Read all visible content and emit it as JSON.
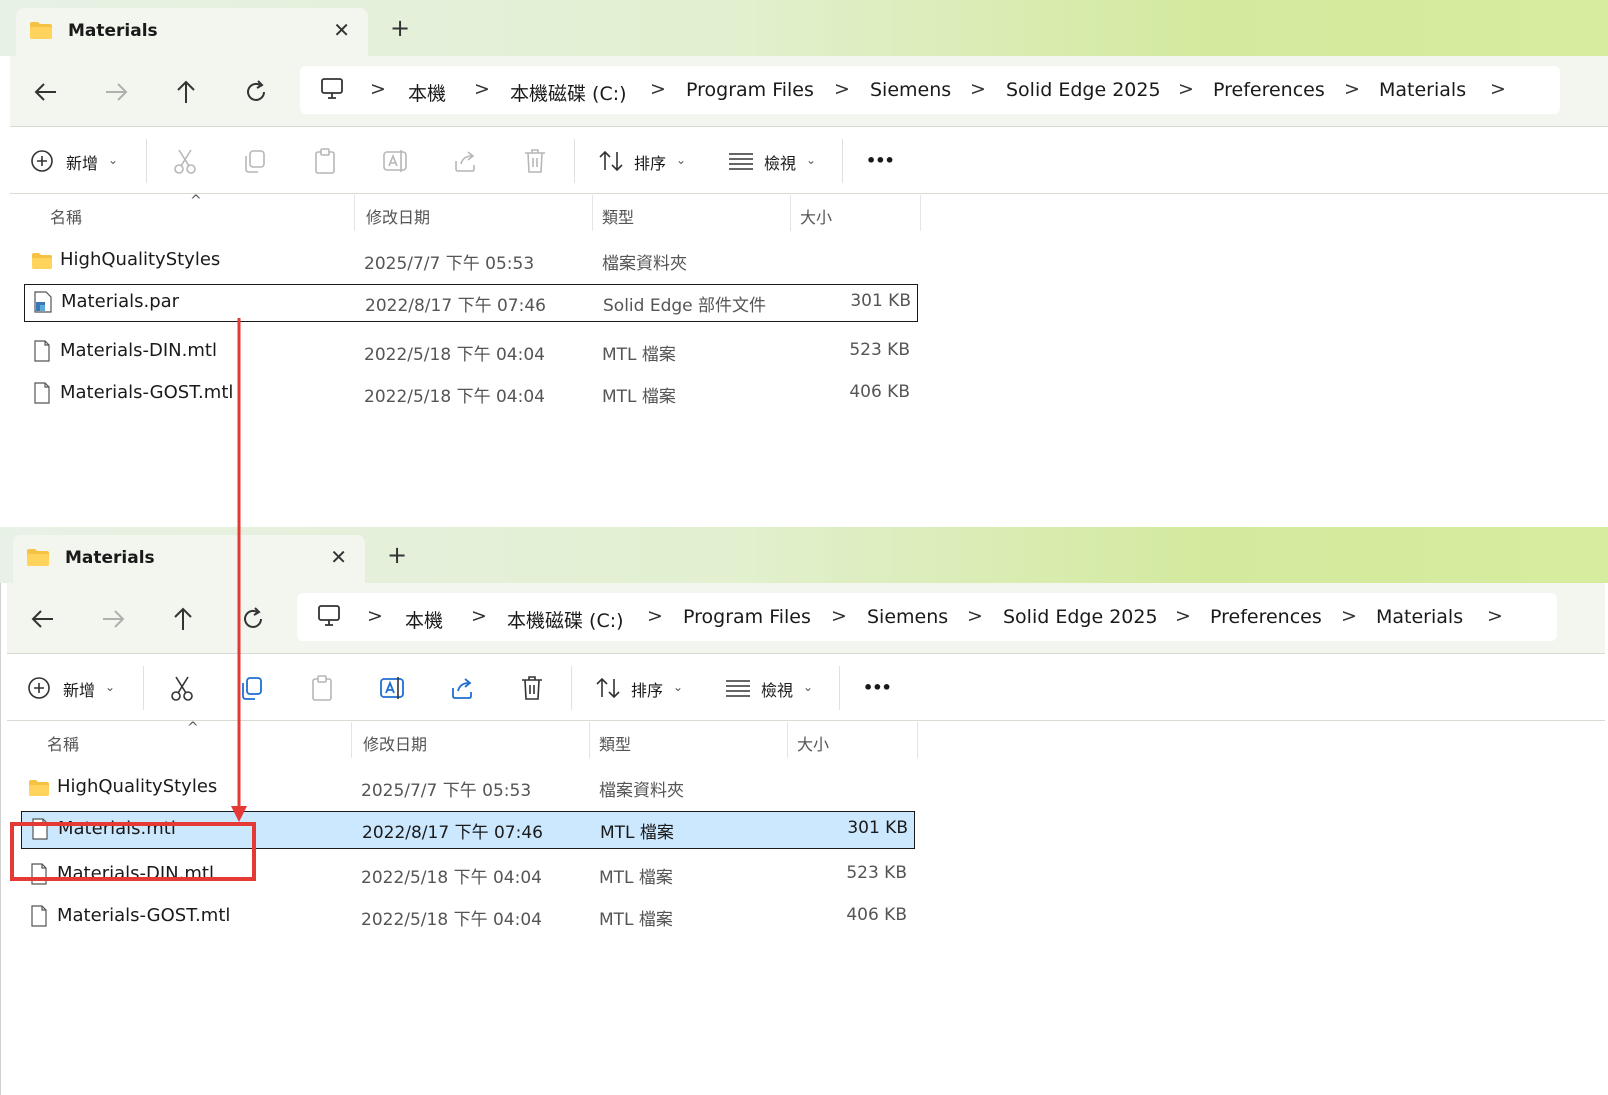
{
  "tab": {
    "title": "Materials",
    "close": "✕",
    "new_tab": "+"
  },
  "breadcrumbs": [
    "本機",
    "本機磁碟 (C:)",
    "Program Files",
    "Siemens",
    "Solid Edge 2025",
    "Preferences",
    "Materials"
  ],
  "toolbar": {
    "new_label": "新增",
    "sort_label": "排序",
    "view_label": "檢視",
    "more_label": "•••"
  },
  "columns": {
    "name": "名稱",
    "date": "修改日期",
    "type": "類型",
    "size": "大小"
  },
  "top_window": {
    "files": [
      {
        "name": "HighQualityStyles",
        "date": "2025/7/7 下午 05:53",
        "type": "檔案資料夾",
        "size": "",
        "icon": "folder-icon"
      },
      {
        "name": "Materials.par",
        "date": "2022/8/17 下午 07:46",
        "type": "Solid Edge 部件文件",
        "size": "301 KB",
        "icon": "part-file-icon"
      },
      {
        "name": "Materials-DIN.mtl",
        "date": "2022/5/18 下午 04:04",
        "type": "MTL 檔案",
        "size": "523 KB",
        "icon": "file-icon"
      },
      {
        "name": "Materials-GOST.mtl",
        "date": "2022/5/18 下午 04:04",
        "type": "MTL 檔案",
        "size": "406 KB",
        "icon": "file-icon"
      }
    ]
  },
  "bottom_window": {
    "files": [
      {
        "name": "HighQualityStyles",
        "date": "2025/7/7 下午 05:53",
        "type": "檔案資料夾",
        "size": "",
        "icon": "folder-icon"
      },
      {
        "name": "Materials.mtl",
        "date": "2022/8/17 下午 07:46",
        "type": "MTL 檔案",
        "size": "301 KB",
        "icon": "file-icon"
      },
      {
        "name": "Materials-DIN.mtl",
        "date": "2022/5/18 下午 04:04",
        "type": "MTL 檔案",
        "size": "523 KB",
        "icon": "file-icon"
      },
      {
        "name": "Materials-GOST.mtl",
        "date": "2022/5/18 下午 04:04",
        "type": "MTL 檔案",
        "size": "406 KB",
        "icon": "file-icon"
      }
    ]
  },
  "colors": {
    "annotation": "#e53935",
    "selection": "#cce8ff",
    "accent": "#d3ea9e"
  }
}
